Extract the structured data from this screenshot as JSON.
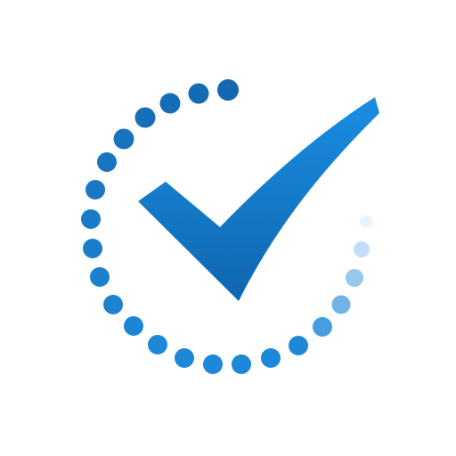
{
  "icon": {
    "name": "checkmark-progress-icon",
    "colors": {
      "background": "#ffffff",
      "dot_dark": "#1268b0",
      "dot_mid": "#1e88d8",
      "dot_light": "#e8f4ff",
      "check_top": "#1a8ee2",
      "check_bottom": "#0f66b0"
    }
  }
}
